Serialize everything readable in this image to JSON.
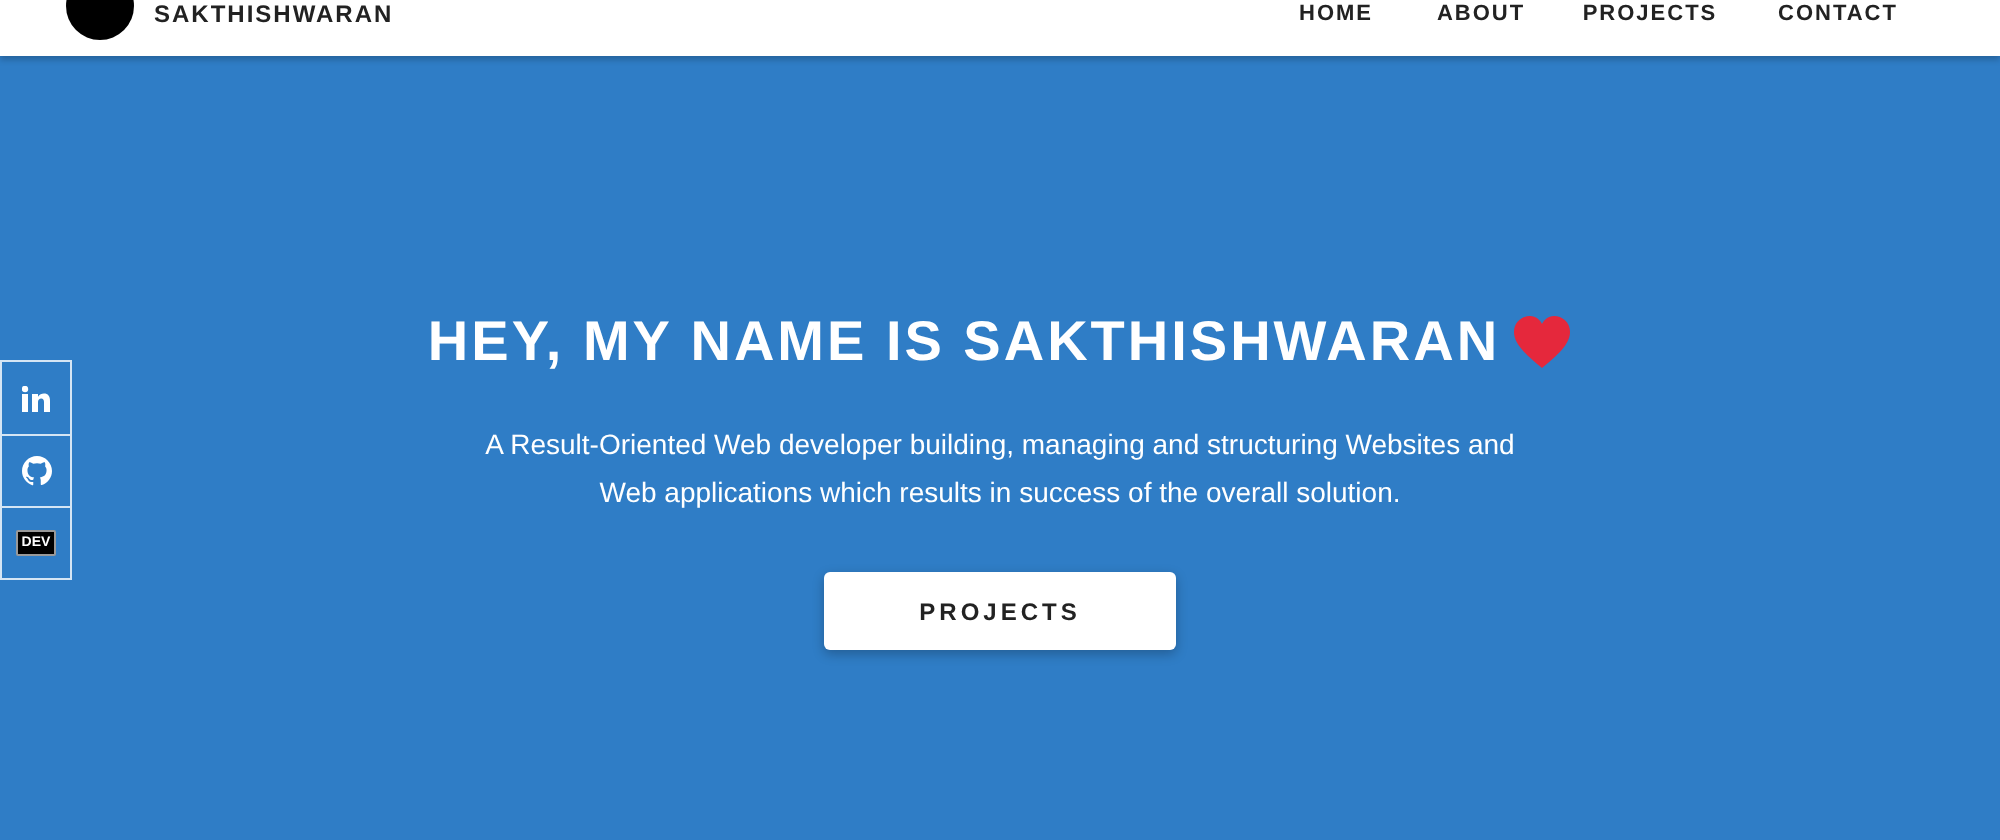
{
  "header": {
    "brand": "SAKTHISHWARAN",
    "nav": [
      {
        "label": "HOME"
      },
      {
        "label": "ABOUT"
      },
      {
        "label": "PROJECTS"
      },
      {
        "label": "CONTACT"
      }
    ]
  },
  "social": [
    {
      "kind": "linkedin"
    },
    {
      "kind": "github"
    },
    {
      "kind": "dev",
      "label": "DEV"
    }
  ],
  "hero": {
    "title": "HEY, MY NAME IS SAKTHISHWARAN",
    "subtitle": "A Result-Oriented Web developer building, managing and structuring Websites and Web applications which results in success of the overall solution.",
    "button": "PROJECTS"
  }
}
